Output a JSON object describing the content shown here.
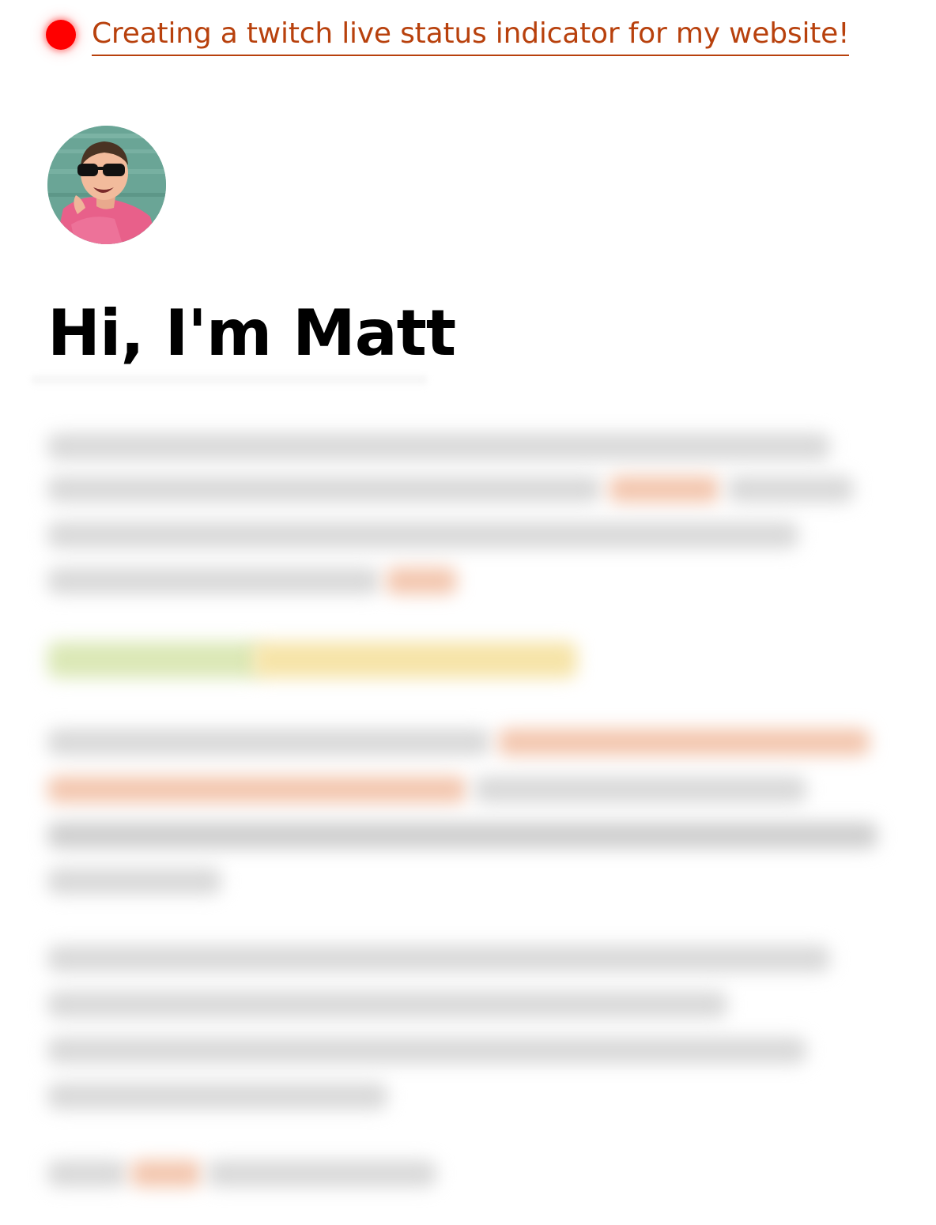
{
  "live_status": {
    "text": "Creating a twitch live status indicator for my website!",
    "dot_color": "#ff0000",
    "link_color": "#b8410d"
  },
  "avatar": {
    "icon": "profile-photo"
  },
  "heading": {
    "title": "Hi, I'm Matt"
  }
}
